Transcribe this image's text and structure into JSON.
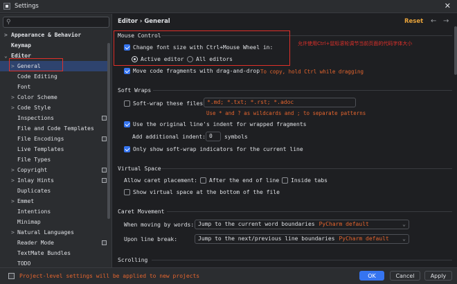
{
  "window": {
    "title": "Settings",
    "close": "✕"
  },
  "search": {
    "placeholder": "",
    "icon": "search-icon"
  },
  "sidebar": {
    "items": [
      {
        "label": "Appearance & Behavior",
        "arrow": ">"
      },
      {
        "label": "Keymap",
        "arrow": ""
      },
      {
        "label": "Editor",
        "arrow": "⌄"
      },
      {
        "label": "General",
        "arrow": ">"
      },
      {
        "label": "Code Editing",
        "arrow": ""
      },
      {
        "label": "Font",
        "arrow": ""
      },
      {
        "label": "Color Scheme",
        "arrow": ">"
      },
      {
        "label": "Code Style",
        "arrow": ">"
      },
      {
        "label": "Inspections",
        "arrow": ""
      },
      {
        "label": "File and Code Templates",
        "arrow": ""
      },
      {
        "label": "File Encodings",
        "arrow": ""
      },
      {
        "label": "Live Templates",
        "arrow": ""
      },
      {
        "label": "File Types",
        "arrow": ""
      },
      {
        "label": "Copyright",
        "arrow": ">"
      },
      {
        "label": "Inlay Hints",
        "arrow": ">"
      },
      {
        "label": "Duplicates",
        "arrow": ""
      },
      {
        "label": "Emmet",
        "arrow": ">"
      },
      {
        "label": "Intentions",
        "arrow": ""
      },
      {
        "label": "Minimap",
        "arrow": ""
      },
      {
        "label": "Natural Languages",
        "arrow": ">"
      },
      {
        "label": "Reader Mode",
        "arrow": ""
      },
      {
        "label": "TextMate Bundles",
        "arrow": ""
      },
      {
        "label": "TODO",
        "arrow": ""
      }
    ]
  },
  "header": {
    "breadcrumb": "Editor › General",
    "reset": "Reset",
    "back": "←",
    "forward": "→"
  },
  "mouse_control": {
    "title": "Mouse Control",
    "change_font": "Change font size with Ctrl+Mouse Wheel in:",
    "active_editor": "Active editor",
    "all_editors": "All editors",
    "move_fragments": "Move code fragments with drag-and-drop",
    "move_hint": "To copy, hold Ctrl while dragging",
    "annotation": "允许使用Ctrl+鼠标滚轮调节当前页面的代码字体大小"
  },
  "soft_wraps": {
    "title": "Soft Wraps",
    "soft_wrap_files": "Soft-wrap these files:",
    "files_value": "*.md; *.txt; *.rst; *.adoc",
    "files_hint": "Use * and ? as wildcards and ; to separate patterns",
    "use_indent": "Use the original line's indent for wrapped fragments",
    "add_indent": "Add additional indent:",
    "indent_value": "0",
    "symbols": "symbols",
    "only_show": "Only show soft-wrap indicators for the current line"
  },
  "virtual_space": {
    "title": "Virtual Space",
    "allow_caret": "Allow caret placement:",
    "after_end": "After the end of line",
    "inside_tabs": "Inside tabs",
    "show_virtual": "Show virtual space at the bottom of the file"
  },
  "caret_movement": {
    "title": "Caret Movement",
    "moving_words": "When moving by words:",
    "moving_value": "Jump to the current word boundaries",
    "moving_sub": "PyCharm default",
    "upon_break": "Upon line break:",
    "break_value": "Jump to the next/previous line boundaries",
    "break_sub": "PyCharm default"
  },
  "scrolling": {
    "title": "Scrolling"
  },
  "footer": {
    "note": "Project-level settings will be applied to new projects",
    "ok": "OK",
    "cancel": "Cancel",
    "apply": "Apply"
  }
}
